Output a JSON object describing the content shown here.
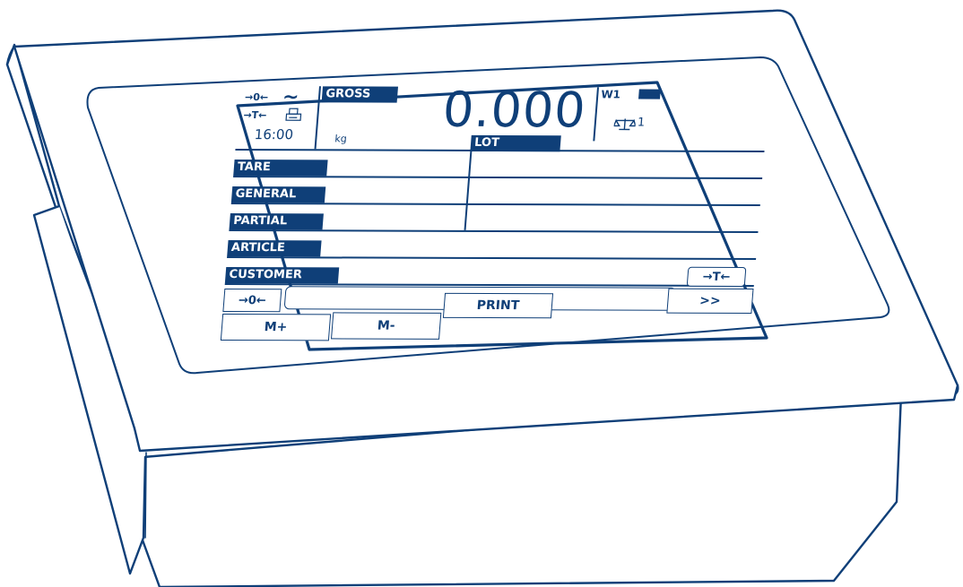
{
  "status": {
    "zero_indicator": "→0←",
    "stability_indicator": "~",
    "tare_indicator": "→T←",
    "printer_icon": "printer-icon",
    "time": "16:00"
  },
  "weight": {
    "mode_label": "GROSS",
    "value": "0.000",
    "unit": "kg",
    "scale_label": "W1",
    "scale_number": "1",
    "scale_icon": "balance-icon",
    "battery_icon": "battery-icon"
  },
  "fields": {
    "lot": "LOT",
    "tare": "TARE",
    "general": "GENERAL",
    "partial": "PARTIAL",
    "article": "ARTICLE",
    "customer": "CUSTOMER"
  },
  "controls": {
    "tare_button": "→T←",
    "zero_button": "→0←",
    "message_bar": ""
  },
  "buttons": {
    "m_plus": "M+",
    "m_minus": "M-",
    "print": "PRINT",
    "more": ">>"
  },
  "colors": {
    "ink": "#0f3f78",
    "background": "#ffffff"
  }
}
